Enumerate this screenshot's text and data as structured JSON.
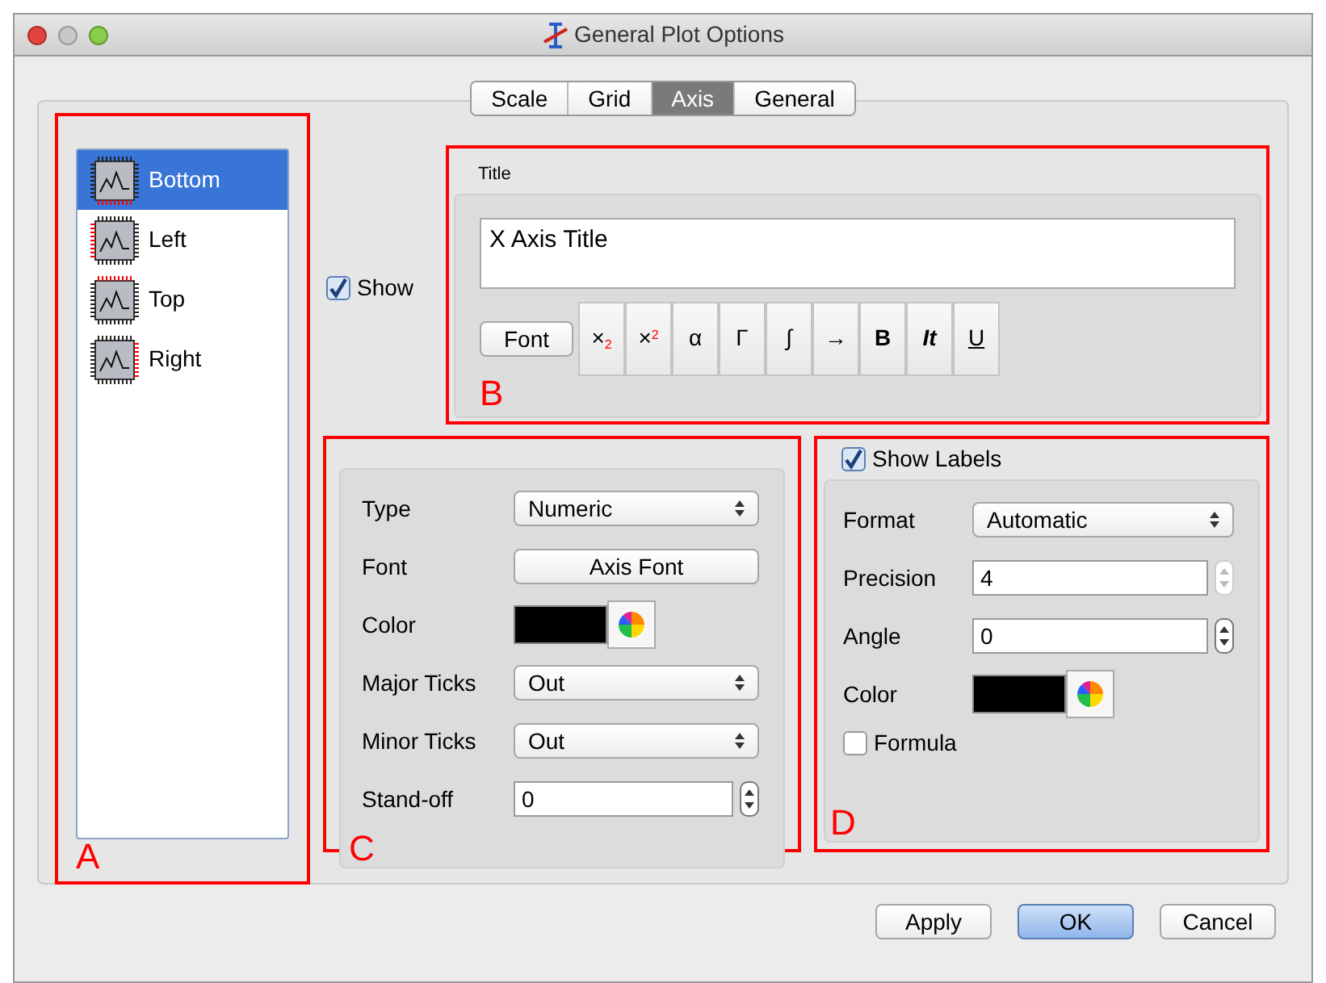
{
  "window": {
    "title": "General Plot Options"
  },
  "tabs": [
    {
      "label": "Scale",
      "selected": false
    },
    {
      "label": "Grid",
      "selected": false
    },
    {
      "label": "Axis",
      "selected": true
    },
    {
      "label": "General",
      "selected": false
    }
  ],
  "axes": [
    {
      "label": "Bottom",
      "kind": "bottom",
      "selected": true
    },
    {
      "label": "Left",
      "kind": "left",
      "selected": false
    },
    {
      "label": "Top",
      "kind": "top",
      "selected": false
    },
    {
      "label": "Right",
      "kind": "right",
      "selected": false
    }
  ],
  "show": {
    "label": "Show",
    "checked": true
  },
  "title_group": {
    "heading": "Title",
    "value": "X Axis Title",
    "font_button": "Font",
    "format_buttons": [
      {
        "label": "×$_{2}$",
        "kind": "plain"
      },
      {
        "label": "×$^{2}$",
        "kind": "plain"
      },
      {
        "label": "α",
        "kind": "plain"
      },
      {
        "label": "Γ",
        "kind": "plain"
      },
      {
        "label": "∫",
        "kind": "plain"
      },
      {
        "label": "→",
        "kind": "plain"
      },
      {
        "label": "B",
        "kind": "bold"
      },
      {
        "label": "It",
        "kind": "italic"
      },
      {
        "label": "U",
        "kind": "underline"
      }
    ]
  },
  "axis_group": {
    "rows": [
      {
        "label": "Type",
        "kind": "select",
        "value": "Numeric"
      },
      {
        "label": "Font",
        "kind": "button",
        "value": "Axis Font"
      },
      {
        "label": "Color",
        "kind": "color",
        "color": "#000000"
      },
      {
        "label": "Major Ticks",
        "kind": "select",
        "value": "Out"
      },
      {
        "label": "Minor Ticks",
        "kind": "select",
        "value": "Out"
      },
      {
        "label": "Stand-off",
        "kind": "spin",
        "value": "0",
        "disabled": false
      }
    ]
  },
  "labels_group": {
    "show_labels": {
      "label": "Show Labels",
      "checked": true
    },
    "rows": [
      {
        "label": "Format",
        "kind": "select",
        "value": "Automatic"
      },
      {
        "label": "Precision",
        "kind": "spin",
        "value": "4",
        "disabled": true
      },
      {
        "label": "Angle",
        "kind": "spin",
        "value": "0",
        "disabled": false
      },
      {
        "label": "Color",
        "kind": "color",
        "color": "#000000"
      }
    ],
    "formula": {
      "label": "Formula",
      "checked": false
    }
  },
  "annotations": [
    "A",
    "B",
    "C",
    "D"
  ],
  "buttons": [
    {
      "label": "Apply",
      "default": false
    },
    {
      "label": "OK",
      "default": true
    },
    {
      "label": "Cancel",
      "default": false
    }
  ]
}
